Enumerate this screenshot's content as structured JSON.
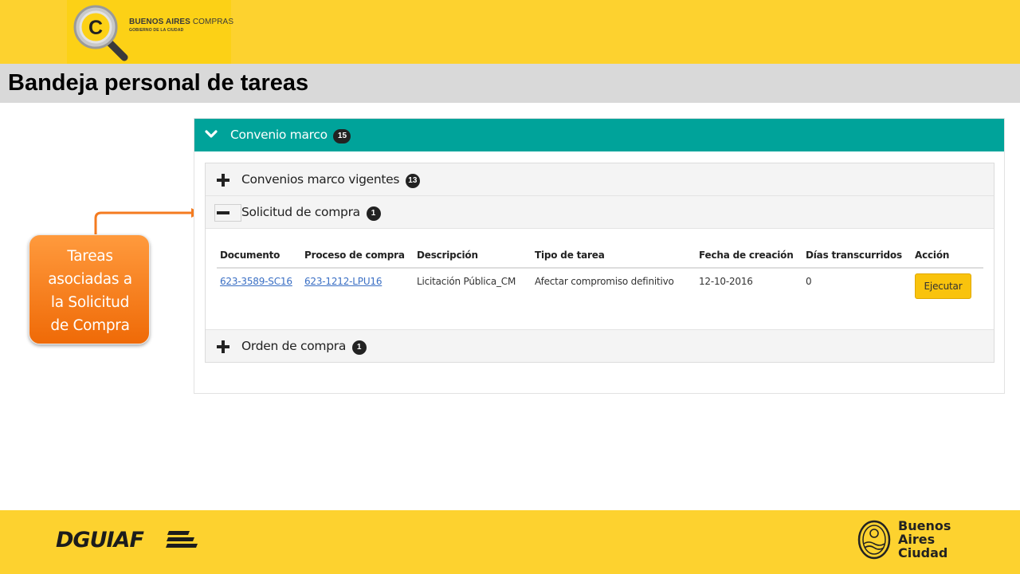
{
  "brand": {
    "logo_letter": "C",
    "name_bold": "BUENOS AIRES",
    "name_light": " COMPRAS",
    "subtitle": "GOBIERNO DE LA CIUDAD"
  },
  "page_title": "Bandeja personal de tareas",
  "panel": {
    "title": "Convenio marco",
    "count": "15",
    "sections": [
      {
        "title": "Convenios marco vigentes",
        "count": "13",
        "state": "collapsed"
      },
      {
        "title": "Solicitud de compra",
        "count": "1",
        "state": "expanded"
      },
      {
        "title": "Orden de compra",
        "count": "1",
        "state": "collapsed"
      }
    ]
  },
  "table": {
    "columns": [
      "Documento",
      "Proceso de compra",
      "Descripción",
      "Tipo de tarea",
      "Fecha de creación",
      "Días transcurridos",
      "Acción"
    ],
    "rows": [
      {
        "documento": "623-3589-SC16",
        "proceso": "623-1212-LPU16",
        "descripcion": "Licitación Pública_CM",
        "tipo": "Afectar compromiso definitivo",
        "fecha": "12-10-2016",
        "dias": "0",
        "accion": "Ejecutar"
      }
    ]
  },
  "callout": {
    "lines": [
      "Tareas",
      "asociadas a",
      "la Solicitud",
      "de Compra"
    ]
  },
  "footer": {
    "left_logo": "DGUIAF",
    "right_logo_lines": [
      "Buenos",
      "Aires",
      "Ciudad"
    ]
  },
  "colors": {
    "yellow_band": "#fdd22f",
    "teal_header": "#00a39a",
    "callout_orange": "#f47b20",
    "button_yellow": "#f9c30d",
    "link_blue": "#3a6fc4"
  }
}
